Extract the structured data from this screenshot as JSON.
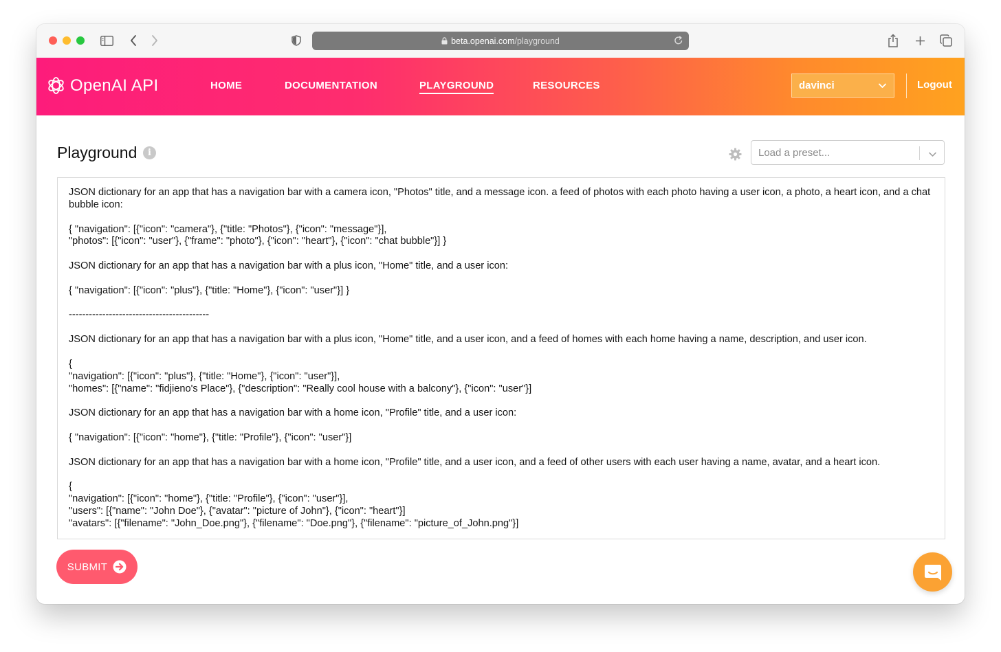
{
  "browser": {
    "url_host": "beta.openai.com",
    "url_path": "/playground"
  },
  "header": {
    "logo_text": "OpenAI API",
    "nav": [
      {
        "label": "HOME",
        "active": false
      },
      {
        "label": "DOCUMENTATION",
        "active": false
      },
      {
        "label": "PLAYGROUND",
        "active": true
      },
      {
        "label": "RESOURCES",
        "active": false
      }
    ],
    "model": "davinci",
    "logout": "Logout"
  },
  "page": {
    "title": "Playground",
    "info_icon_glyph": "i",
    "preset_placeholder": "Load a preset...",
    "submit_label": "SUBMIT"
  },
  "editor": {
    "lines": [
      "JSON dictionary for an app that has a navigation bar with a camera icon, \"Photos\" title, and a message icon. a feed of photos with each photo having a user icon, a photo, a heart icon, and a chat bubble icon:",
      "",
      "{ \"navigation\": [{\"icon\": \"camera\"}, {\"title: \"Photos\"}, {\"icon\": \"message\"}],",
      "\"photos\": [{\"icon\": \"user\"}, {\"frame\": \"photo\"}, {\"icon\": \"heart\"}, {\"icon\": \"chat bubble\"}] }",
      "",
      "JSON dictionary for an app that has a navigation bar with a plus icon, \"Home\" title, and a user icon:",
      "",
      "{ \"navigation\": [{\"icon\": \"plus\"}, {\"title: \"Home\"}, {\"icon\": \"user\"}] }",
      "",
      "------------------------------------------",
      "",
      "JSON dictionary for an app that has a navigation bar with a plus icon, \"Home\" title, and a user icon, and a feed of homes with each home having a name, description, and user icon.",
      "",
      "{",
      "\"navigation\": [{\"icon\": \"plus\"}, {\"title: \"Home\"}, {\"icon\": \"user\"}],",
      "\"homes\": [{\"name\": \"fidjieno's Place\"}, {\"description\": \"Really cool house with a balcony\"}, {\"icon\": \"user\"}]",
      "",
      "JSON dictionary for an app that has a navigation bar with a home icon, \"Profile\" title, and a user icon:",
      "",
      "{ \"navigation\": [{\"icon\": \"home\"}, {\"title: \"Profile\"}, {\"icon\": \"user\"}]",
      "",
      "JSON dictionary for an app that has a navigation bar with a home icon, \"Profile\" title, and a user icon, and a feed of other users with each user having a name, avatar, and a heart icon.",
      "",
      "{",
      "\"navigation\": [{\"icon\": \"home\"}, {\"title: \"Profile\"}, {\"icon\": \"user\"}],",
      "\"users\": [{\"name\": \"John Doe\"}, {\"avatar\": \"picture of John\"}, {\"icon\": \"heart\"}]",
      "\"avatars\": [{\"filename\": \"John_Doe.png\"}, {\"filename\": \"Doe.png\"}, {\"filename\": \"picture_of_John.png\"}]"
    ]
  },
  "icons": {
    "sidebar": "sidebar-icon",
    "back": "chevron-left-icon",
    "forward": "chevron-right-icon",
    "shield": "shield-icon",
    "lock": "lock-icon",
    "reload": "reload-icon",
    "share": "share-icon",
    "new_tab": "plus-icon",
    "tabs": "tabs-overview-icon",
    "logo": "openai-logo-icon",
    "gear": "gear-icon",
    "chat": "chat-icon"
  },
  "colors": {
    "header_gradient_start": "#fd1c7b",
    "header_gradient_end": "#ffa21f",
    "submit": "#ff5a6e",
    "chat_fab": "#fba233",
    "model_select": "#fbb04a"
  }
}
